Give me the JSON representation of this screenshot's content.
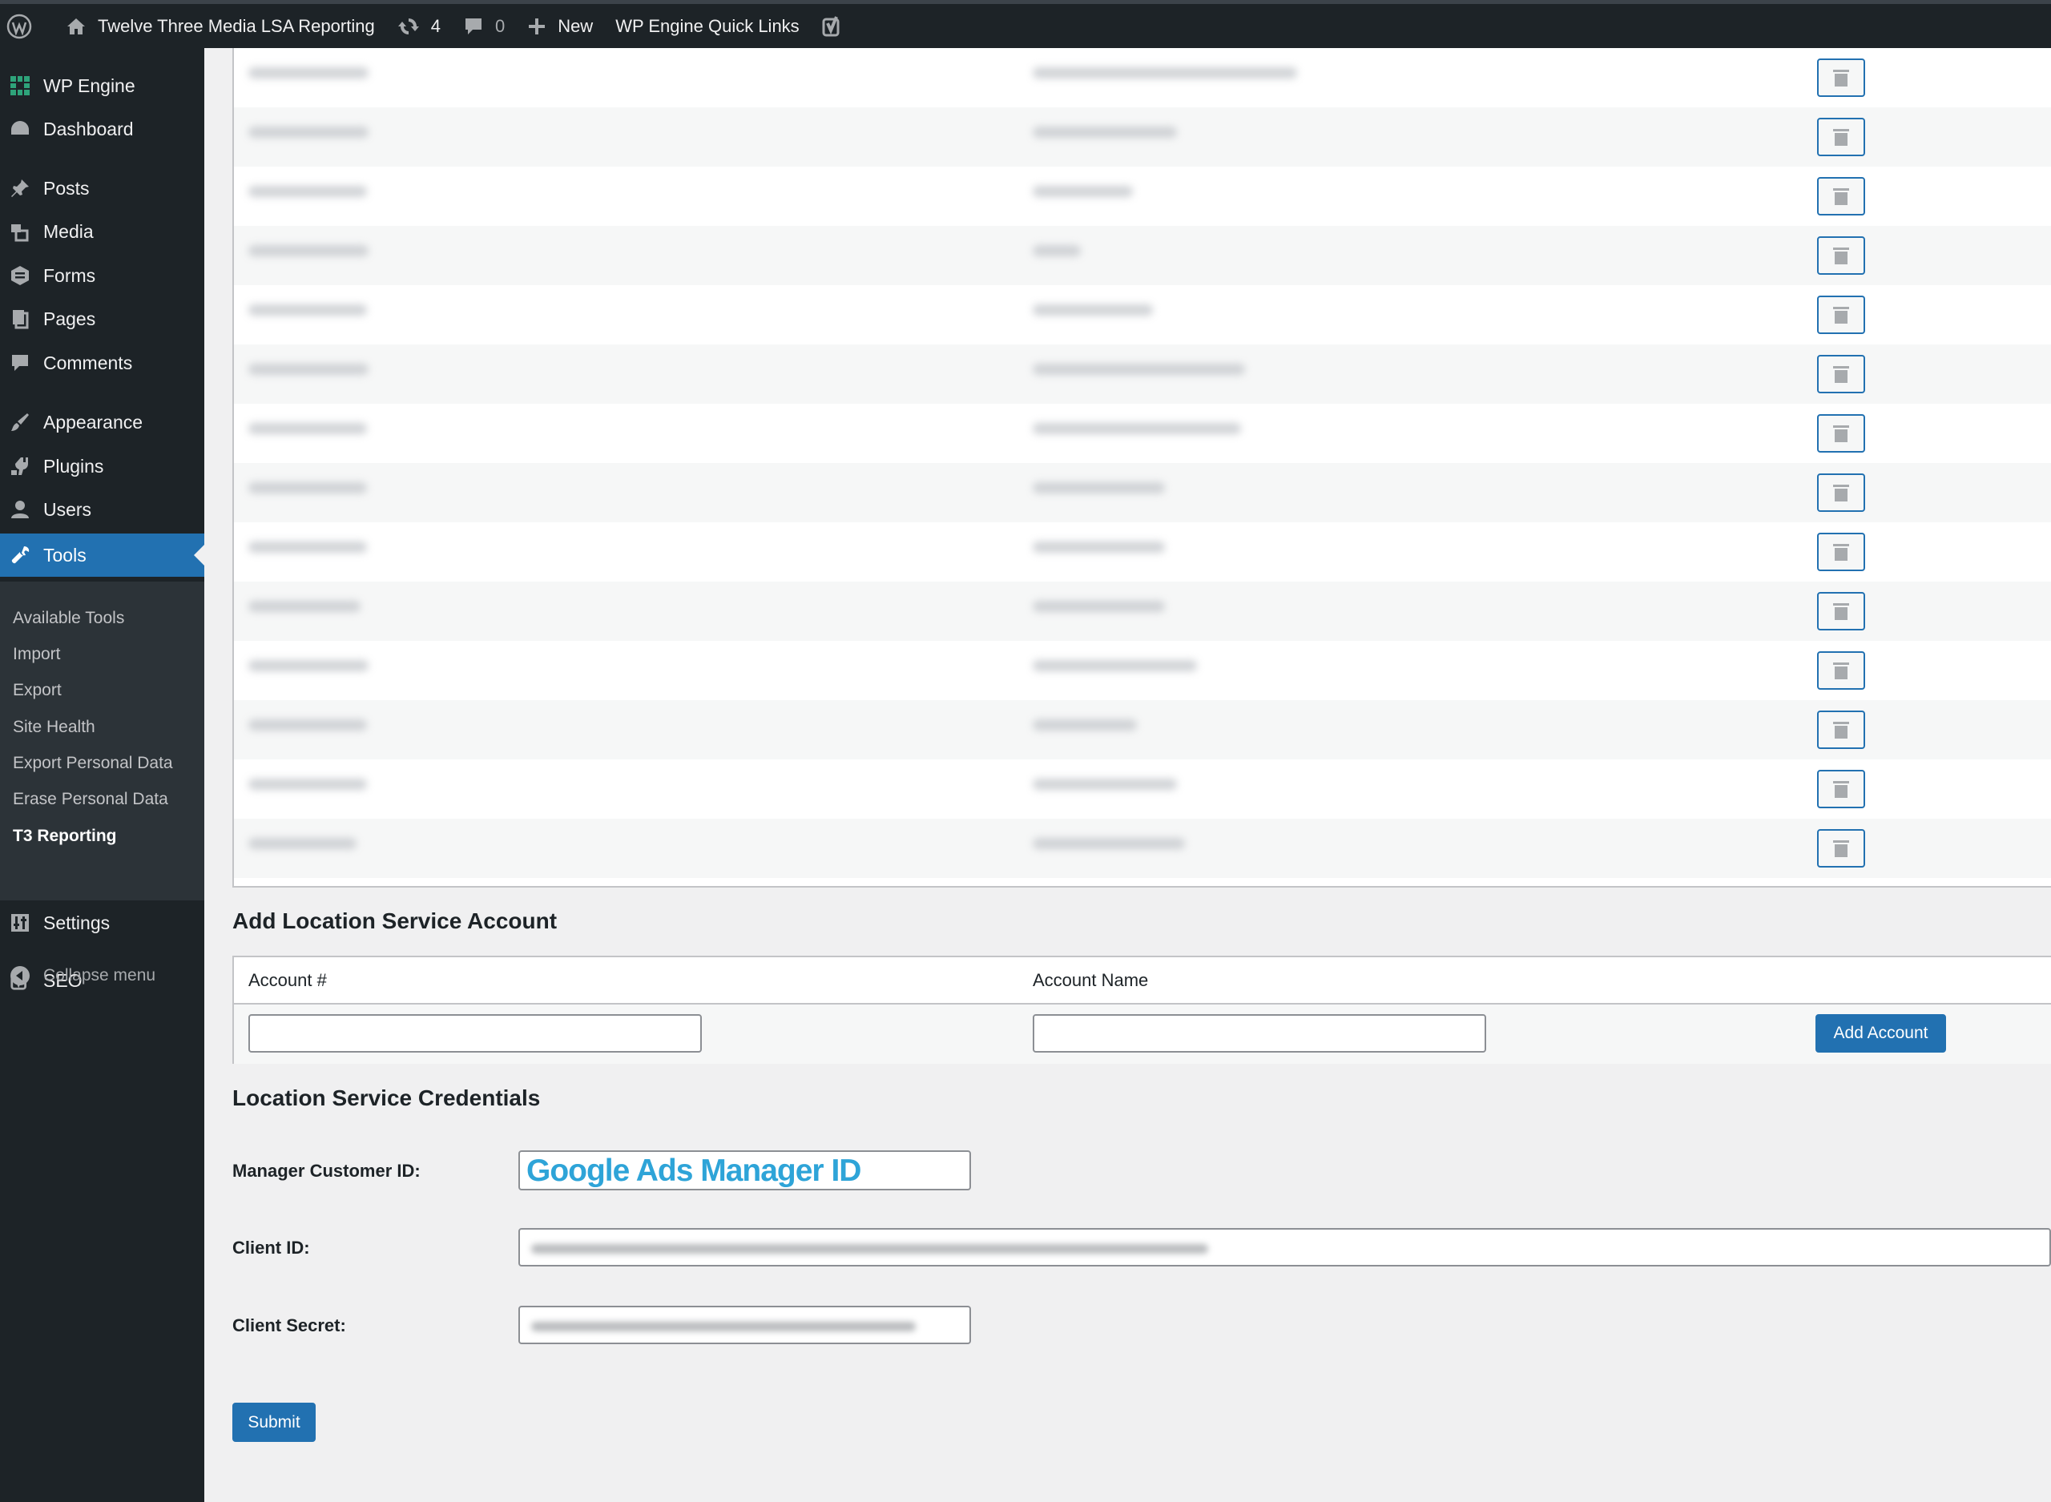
{
  "admin_bar": {
    "site_name": "Twelve Three Media LSA Reporting",
    "updates_count": "4",
    "comments_count": "0",
    "new_label": "New",
    "quick_links_label": "WP Engine Quick Links"
  },
  "sidebar": {
    "items": [
      {
        "label": "WP Engine",
        "icon": "wp-engine-icon"
      },
      {
        "label": "Dashboard",
        "icon": "dashboard-icon"
      },
      {
        "label": "Posts",
        "icon": "pin-icon"
      },
      {
        "label": "Media",
        "icon": "media-icon"
      },
      {
        "label": "Forms",
        "icon": "forms-icon"
      },
      {
        "label": "Pages",
        "icon": "pages-icon"
      },
      {
        "label": "Comments",
        "icon": "comment-icon"
      },
      {
        "label": "Appearance",
        "icon": "brush-icon"
      },
      {
        "label": "Plugins",
        "icon": "plugin-icon"
      },
      {
        "label": "Users",
        "icon": "user-icon"
      },
      {
        "label": "Tools",
        "icon": "wrench-icon",
        "current": true
      },
      {
        "label": "Settings",
        "icon": "settings-icon"
      },
      {
        "label": "SEO",
        "icon": "yoast-icon"
      }
    ],
    "tools_submenu": [
      "Available Tools",
      "Import",
      "Export",
      "Site Health",
      "Export Personal Data",
      "Erase Personal Data",
      "T3 Reporting"
    ],
    "collapse_label": "Collapse menu"
  },
  "add_section": {
    "heading": "Add Location Service Account",
    "col_account_number": "Account #",
    "col_account_name": "Account Name",
    "account_number_value": "",
    "account_name_value": "",
    "add_button": "Add Account"
  },
  "credentials": {
    "heading": "Location Service Credentials",
    "manager_label": "Manager Customer ID:",
    "manager_value": "Google Ads Manager ID",
    "client_id_label": "Client ID:",
    "client_secret_label": "Client Secret:",
    "submit_label": "Submit"
  },
  "colors": {
    "admin_bar": "#1d2327",
    "accent": "#2271b1",
    "page_bg": "#f0f0f1",
    "overlay_text": "#2ea4d8"
  }
}
